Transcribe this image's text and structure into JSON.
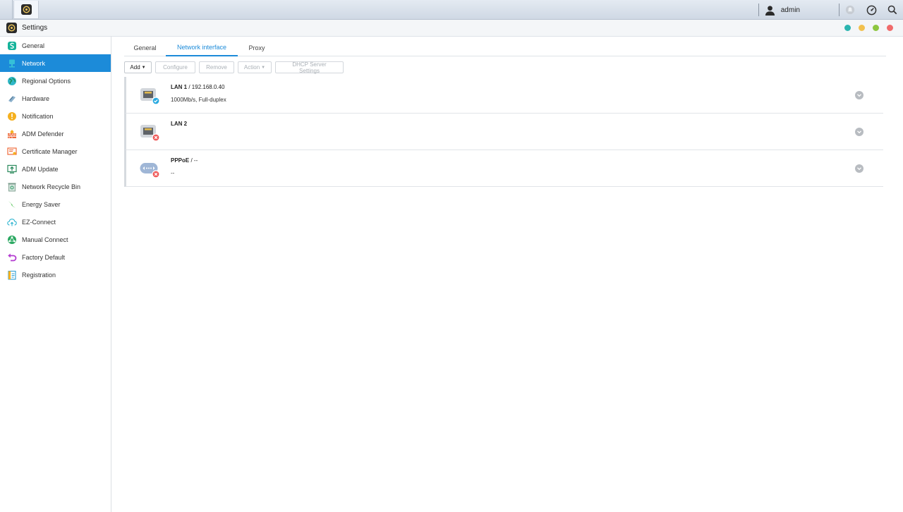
{
  "taskbar": {
    "user": "admin"
  },
  "window": {
    "title": "Settings"
  },
  "colors": {
    "accent": "#1c8bd9",
    "win_btn_1": "#2bb5b0",
    "win_btn_2": "#f2c14e",
    "win_btn_3": "#8dc63f",
    "win_btn_4": "#f06b6b",
    "status_ok": "#29a9e0",
    "status_err": "#ee5a5a"
  },
  "sidebar": {
    "items": [
      {
        "label": "General",
        "icon": "general-icon"
      },
      {
        "label": "Network",
        "icon": "network-icon"
      },
      {
        "label": "Regional Options",
        "icon": "regional-options-icon"
      },
      {
        "label": "Hardware",
        "icon": "hardware-icon"
      },
      {
        "label": "Notification",
        "icon": "notification-icon"
      },
      {
        "label": "ADM Defender",
        "icon": "adm-defender-icon"
      },
      {
        "label": "Certificate Manager",
        "icon": "certificate-icon"
      },
      {
        "label": "ADM Update",
        "icon": "adm-update-icon"
      },
      {
        "label": "Network Recycle Bin",
        "icon": "recycle-bin-icon"
      },
      {
        "label": "Energy Saver",
        "icon": "energy-saver-icon"
      },
      {
        "label": "EZ-Connect",
        "icon": "ez-connect-icon"
      },
      {
        "label": "Manual Connect",
        "icon": "manual-connect-icon"
      },
      {
        "label": "Factory Default",
        "icon": "factory-default-icon"
      },
      {
        "label": "Registration",
        "icon": "registration-icon"
      }
    ],
    "active_index": 1
  },
  "tabs": [
    {
      "label": "General"
    },
    {
      "label": "Network interface"
    },
    {
      "label": "Proxy"
    }
  ],
  "toolbar": {
    "add": "Add",
    "configure": "Configure",
    "remove": "Remove",
    "action": "Action",
    "dhcp": "DHCP Server Settings"
  },
  "interfaces": [
    {
      "name": "LAN 1",
      "addr": " / 192.168.0.40",
      "detail": "1000Mb/s, Full-duplex",
      "status": "connected"
    },
    {
      "name": "LAN 2",
      "addr": "",
      "detail": "",
      "status": "disconnected"
    },
    {
      "name": "PPPoE",
      "addr": " / --",
      "detail": "--",
      "status": "disconnected"
    }
  ]
}
